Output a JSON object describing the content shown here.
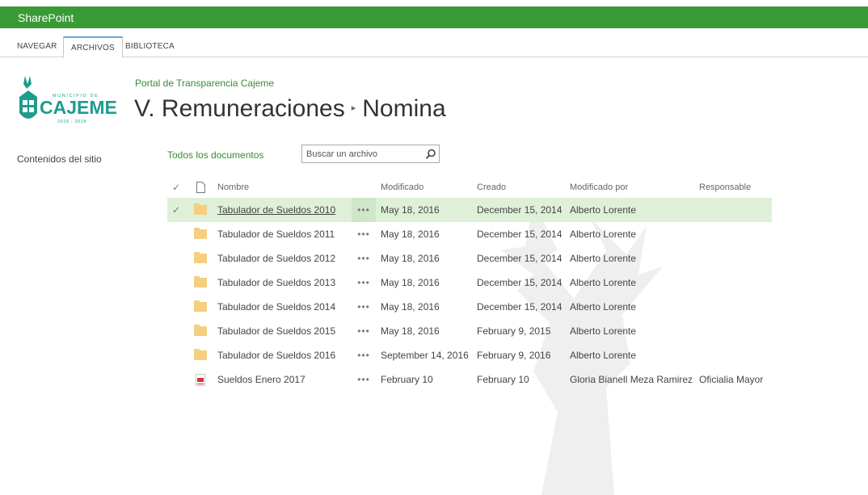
{
  "suite_bar": {
    "brand": "SharePoint"
  },
  "ribbon": {
    "tabs": [
      {
        "label": "NAVEGAR"
      },
      {
        "label": "ARCHIVOS"
      },
      {
        "label": "BIBLIOTECA"
      }
    ]
  },
  "logo": {
    "top_text": "MUNICIPIO DE",
    "name": "CAJEME",
    "years": "2015 - 2018"
  },
  "site": {
    "link": "Portal de Transparencia Cajeme",
    "title_parent": "V. Remuneraciones",
    "title_separator": "▸",
    "title_current": "Nomina"
  },
  "left_nav": {
    "items": [
      {
        "label": "Contenidos del sitio"
      }
    ]
  },
  "toolbar": {
    "view_label": "Todos los documentos",
    "search_placeholder": "Buscar un archivo"
  },
  "columns": {
    "check": "✓",
    "name": "Nombre",
    "modified": "Modificado",
    "created": "Creado",
    "modified_by": "Modificado por",
    "responsible": "Responsable"
  },
  "rows": [
    {
      "type": "folder",
      "selected": true,
      "check": "✓",
      "name": "Tabulador de Sueldos 2010",
      "dots": "•••",
      "modified": "May 18, 2016",
      "created": "December 15, 2014",
      "modified_by": "Alberto Lorente",
      "responsible": ""
    },
    {
      "type": "folder",
      "selected": false,
      "check": "",
      "name": "Tabulador de Sueldos 2011",
      "dots": "•••",
      "modified": "May 18, 2016",
      "created": "December 15, 2014",
      "modified_by": "Alberto Lorente",
      "responsible": ""
    },
    {
      "type": "folder",
      "selected": false,
      "check": "",
      "name": "Tabulador de Sueldos 2012",
      "dots": "•••",
      "modified": "May 18, 2016",
      "created": "December 15, 2014",
      "modified_by": "Alberto Lorente",
      "responsible": ""
    },
    {
      "type": "folder",
      "selected": false,
      "check": "",
      "name": "Tabulador de Sueldos 2013",
      "dots": "•••",
      "modified": "May 18, 2016",
      "created": "December 15, 2014",
      "modified_by": "Alberto Lorente",
      "responsible": ""
    },
    {
      "type": "folder",
      "selected": false,
      "check": "",
      "name": "Tabulador de Sueldos 2014",
      "dots": "•••",
      "modified": "May 18, 2016",
      "created": "December 15, 2014",
      "modified_by": "Alberto Lorente",
      "responsible": ""
    },
    {
      "type": "folder",
      "selected": false,
      "check": "",
      "name": "Tabulador de Sueldos 2015",
      "dots": "•••",
      "modified": "May 18, 2016",
      "created": "February 9, 2015",
      "modified_by": "Alberto Lorente",
      "responsible": ""
    },
    {
      "type": "folder",
      "selected": false,
      "check": "",
      "name": "Tabulador de Sueldos 2016",
      "dots": "•••",
      "modified": "September 14, 2016",
      "created": "February 9, 2016",
      "modified_by": "Alberto Lorente",
      "responsible": ""
    },
    {
      "type": "pdf",
      "selected": false,
      "check": "",
      "name": "Sueldos Enero 2017",
      "dots": "•••",
      "modified": "February 10",
      "created": "February 10",
      "modified_by": "Gloria Bianell Meza Ramirez",
      "responsible": "Oficialia Mayor"
    }
  ],
  "colors": {
    "suite_bar": "#3a9a35",
    "link": "#3a8a34",
    "selected_row": "#dff0d8",
    "logo": "#1e9c8e"
  }
}
